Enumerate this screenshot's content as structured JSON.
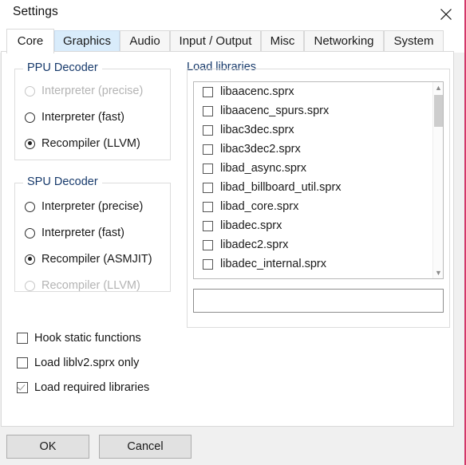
{
  "window": {
    "title": "Settings",
    "close_icon": "close-icon"
  },
  "tabs": [
    {
      "label": "Core",
      "selected": true,
      "hover": false
    },
    {
      "label": "Graphics",
      "selected": false,
      "hover": true
    },
    {
      "label": "Audio",
      "selected": false,
      "hover": false
    },
    {
      "label": "Input / Output",
      "selected": false,
      "hover": false
    },
    {
      "label": "Misc",
      "selected": false,
      "hover": false
    },
    {
      "label": "Networking",
      "selected": false,
      "hover": false
    },
    {
      "label": "System",
      "selected": false,
      "hover": false
    }
  ],
  "ppu_decoder": {
    "title": "PPU Decoder",
    "options": [
      {
        "label": "Interpreter (precise)",
        "checked": false,
        "disabled": true
      },
      {
        "label": "Interpreter (fast)",
        "checked": false,
        "disabled": false
      },
      {
        "label": "Recompiler (LLVM)",
        "checked": true,
        "disabled": false
      }
    ]
  },
  "spu_decoder": {
    "title": "SPU Decoder",
    "options": [
      {
        "label": "Interpreter (precise)",
        "checked": false,
        "disabled": false
      },
      {
        "label": "Interpreter (fast)",
        "checked": false,
        "disabled": false
      },
      {
        "label": "Recompiler (ASMJIT)",
        "checked": true,
        "disabled": false
      },
      {
        "label": "Recompiler (LLVM)",
        "checked": false,
        "disabled": true
      }
    ]
  },
  "load_libraries": {
    "title": "Load libraries",
    "items": [
      {
        "label": "libaacenc.sprx",
        "checked": false
      },
      {
        "label": "libaacenc_spurs.sprx",
        "checked": false
      },
      {
        "label": "libac3dec.sprx",
        "checked": false
      },
      {
        "label": "libac3dec2.sprx",
        "checked": false
      },
      {
        "label": "libad_async.sprx",
        "checked": false
      },
      {
        "label": "libad_billboard_util.sprx",
        "checked": false
      },
      {
        "label": "libad_core.sprx",
        "checked": false
      },
      {
        "label": "libadec.sprx",
        "checked": false
      },
      {
        "label": "libadec2.sprx",
        "checked": false
      },
      {
        "label": "libadec_internal.sprx",
        "checked": false
      }
    ],
    "search": {
      "value": "",
      "placeholder": ""
    },
    "scrollbar": {
      "up_arrow": "▲",
      "down_arrow": "▼"
    }
  },
  "options": [
    {
      "label": "Hook static functions",
      "checked": false
    },
    {
      "label": "Load liblv2.sprx only",
      "checked": false
    },
    {
      "label": "Load required libraries",
      "checked": true
    }
  ],
  "buttons": {
    "ok": "OK",
    "cancel": "Cancel"
  },
  "colors": {
    "accent_tab_hover": "#d9ecfb",
    "group_title": "#16396b",
    "edge": "#d4386a"
  }
}
